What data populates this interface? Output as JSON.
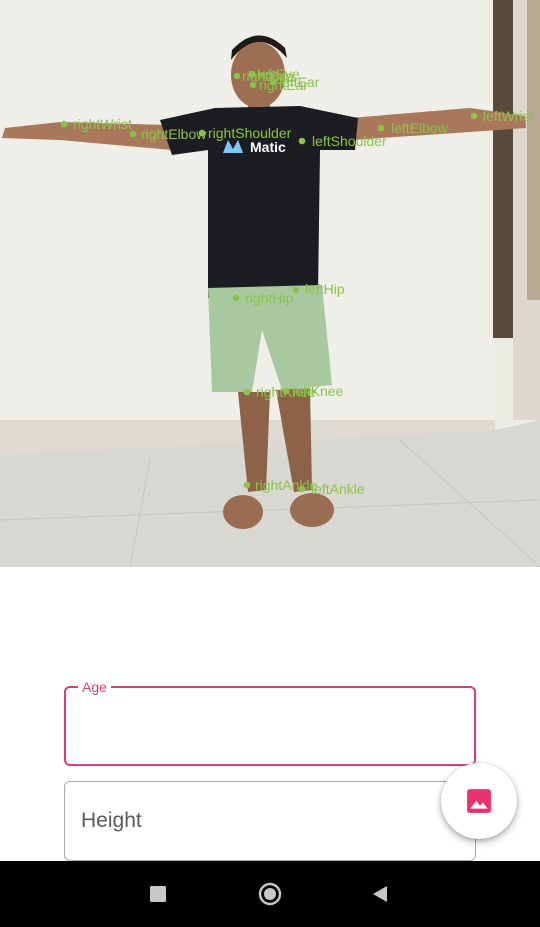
{
  "pose_overlay": {
    "color": "#8bc34a",
    "keypoints": [
      {
        "name": "nose",
        "label": "nose"
      },
      {
        "name": "leftEye",
        "label": "leftEye"
      },
      {
        "name": "rightEye",
        "label": "rightEye"
      },
      {
        "name": "leftEar",
        "label": "leftEar"
      },
      {
        "name": "rightEar",
        "label": "rightEar"
      },
      {
        "name": "leftShoulder",
        "label": "leftShoulder"
      },
      {
        "name": "rightShoulder",
        "label": "rightShoulder"
      },
      {
        "name": "leftElbow",
        "label": "leftElbow"
      },
      {
        "name": "rightElbow",
        "label": "rightElbow"
      },
      {
        "name": "leftWrist",
        "label": "leftWrist"
      },
      {
        "name": "rightWrist",
        "label": "rightWrist"
      },
      {
        "name": "leftHip",
        "label": "leftHip"
      },
      {
        "name": "rightHip",
        "label": "rightHip"
      },
      {
        "name": "leftKnee",
        "label": "leftKnee"
      },
      {
        "name": "rightKnee",
        "label": "rightKnee"
      },
      {
        "name": "leftAnkle",
        "label": "leftAnkle"
      },
      {
        "name": "rightAnkle",
        "label": "rightAnkle"
      }
    ]
  },
  "shirt_logo": "Matic",
  "form": {
    "age": {
      "label": "Age",
      "value": ""
    },
    "height": {
      "label": "Height",
      "value": ""
    }
  },
  "fab": {
    "icon": "image-icon",
    "color": "#e8336e"
  },
  "navbar": {
    "buttons": [
      "recents-icon",
      "home-icon",
      "back-icon"
    ]
  }
}
